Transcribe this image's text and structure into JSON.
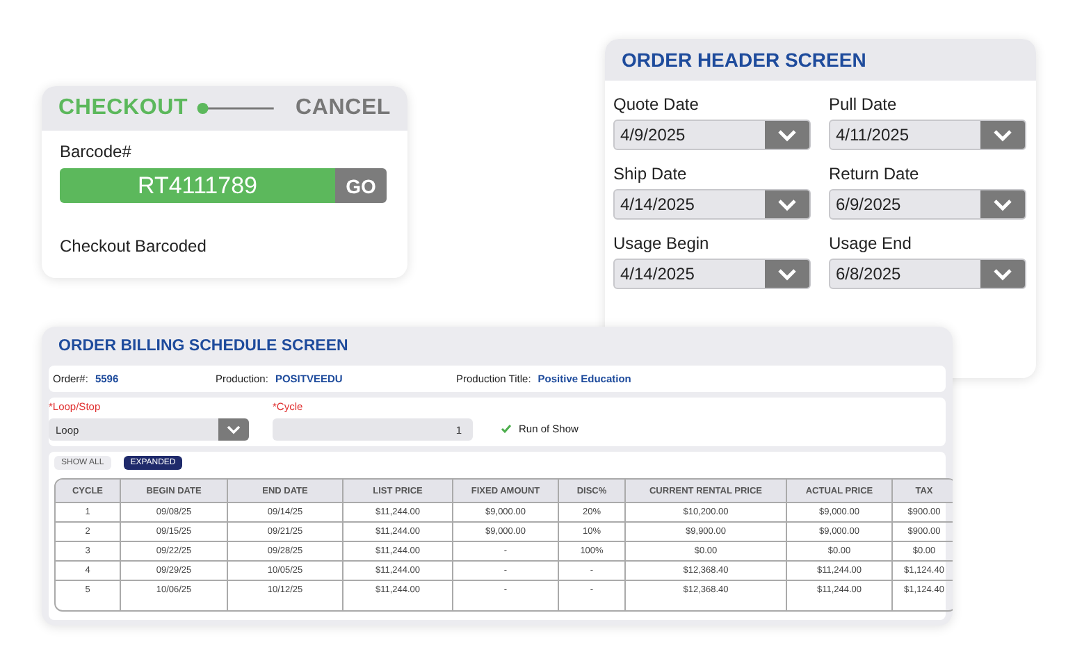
{
  "checkout": {
    "modes": [
      {
        "label": "CHECKOUT",
        "selected": true
      },
      {
        "label": "CANCEL",
        "selected": false
      }
    ],
    "barcode": {
      "label": "Barcode#",
      "value": "RT4111789",
      "button": "GO"
    },
    "status": "Checkout Barcoded"
  },
  "order_header": {
    "title": "ORDER HEADER SCREEN",
    "fields": [
      {
        "label": "Quote Date",
        "value": "4/9/2025"
      },
      {
        "label": "Pull Date",
        "value": "4/11/2025"
      },
      {
        "label": "Ship Date",
        "value": "4/14/2025"
      },
      {
        "label": "Return Date",
        "value": "6/9/2025"
      },
      {
        "label": "Usage Begin",
        "value": "4/14/2025"
      },
      {
        "label": "Usage End",
        "value": "6/8/2025"
      }
    ]
  },
  "billing": {
    "title": "ORDER BILLING SCHEDULE SCREEN",
    "info": [
      {
        "label": "Order#:",
        "value": "5596"
      },
      {
        "label": "Production:",
        "value": "POSITVEEDU"
      },
      {
        "label": "Production Title:",
        "value": "Positive Education"
      }
    ],
    "loop_stop": {
      "label": "*Loop/Stop",
      "value": "Loop"
    },
    "cycle": {
      "label": "*Cycle",
      "value": "1"
    },
    "run_of_show": {
      "label": "Run of Show",
      "checked": true
    },
    "view_buttons": [
      {
        "label": "SHOW ALL",
        "selected": false
      },
      {
        "label": "EXPANDED",
        "selected": true
      }
    ],
    "table": {
      "columns": [
        "CYCLE",
        "BEGIN DATE",
        "END DATE",
        "LIST PRICE",
        "FIXED AMOUNT",
        "DISC%",
        "CURRENT RENTAL PRICE",
        "ACTUAL PRICE",
        "TAX"
      ],
      "rows": [
        [
          "1",
          "09/08/25",
          "09/14/25",
          "$11,244.00",
          "$9,000.00",
          "20%",
          "$10,200.00",
          "$9,000.00",
          "$900.00"
        ],
        [
          "2",
          "09/15/25",
          "09/21/25",
          "$11,244.00",
          "$9,000.00",
          "10%",
          "$9,900.00",
          "$9,000.00",
          "$900.00"
        ],
        [
          "3",
          "09/22/25",
          "09/28/25",
          "$11,244.00",
          "-",
          "100%",
          "$0.00",
          "$0.00",
          "$0.00"
        ],
        [
          "4",
          "09/29/25",
          "10/05/25",
          "$11,244.00",
          "-",
          "-",
          "$12,368.40",
          "$11,244.00",
          "$1,124.40"
        ],
        [
          "5",
          "10/06/25",
          "10/12/25",
          "$11,244.00",
          "-",
          "-",
          "$12,368.40",
          "$11,244.00",
          "$1,124.40"
        ]
      ]
    }
  }
}
